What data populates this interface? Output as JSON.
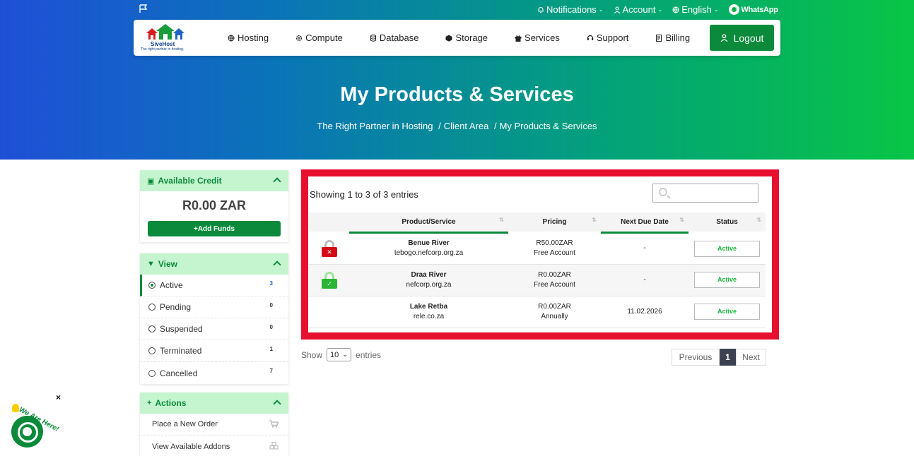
{
  "topbar": {
    "notifications": "Notifications",
    "account": "Account",
    "language": "English",
    "whatsapp": "WhatsApp"
  },
  "logo": {
    "brand": "SiveHost",
    "tagline": "The right partner in hosting."
  },
  "nav": {
    "items": [
      "Hosting",
      "Compute",
      "Database",
      "Storage",
      "Services",
      "Support",
      "Billing"
    ],
    "logout": "Logout"
  },
  "hero": {
    "title": "My Products & Services",
    "breadcrumb": [
      "The Right Partner in Hosting",
      "Client Area",
      "My Products & Services"
    ]
  },
  "sidebar": {
    "credit": {
      "title": "Available Credit",
      "amount": "R0.00 ZAR",
      "add_funds": "Add Funds"
    },
    "view": {
      "title": "View",
      "items": [
        {
          "label": "Active",
          "count": "3"
        },
        {
          "label": "Pending",
          "count": "0"
        },
        {
          "label": "Suspended",
          "count": "0"
        },
        {
          "label": "Terminated",
          "count": "1"
        },
        {
          "label": "Cancelled",
          "count": "7"
        }
      ]
    },
    "actions": {
      "title": "Actions",
      "items": [
        "Place a New Order",
        "View Available Addons"
      ]
    }
  },
  "table": {
    "showing": "Showing 1 to 3 of 3 entries",
    "headers": [
      "Product/Service",
      "Pricing",
      "Next Due Date",
      "Status"
    ],
    "rows": [
      {
        "name": "Benue River",
        "domain": "tebogo.nefcorp.org.za",
        "price": "R50.00ZAR",
        "cycle": "Free Account",
        "due": "-",
        "status": "Active",
        "lock": "red"
      },
      {
        "name": "Draa River",
        "domain": "nefcorp.org.za",
        "price": "R0.00ZAR",
        "cycle": "Free Account",
        "due": "-",
        "status": "Active",
        "lock": "green"
      },
      {
        "name": "Lake Retba",
        "domain": "rele.co.za",
        "price": "R0.00ZAR",
        "cycle": "Annually",
        "due": "11.02.2026",
        "status": "Active",
        "lock": ""
      }
    ]
  },
  "footer": {
    "show": "Show",
    "page_size": "10",
    "entries": "entries",
    "previous": "Previous",
    "page": "1",
    "next": "Next"
  },
  "chat": {
    "label": "We Are Here!",
    "close": "×"
  },
  "colors": {
    "accent": "#0a8a3a",
    "highlight": "#e8102f",
    "status": "#18b43a"
  }
}
